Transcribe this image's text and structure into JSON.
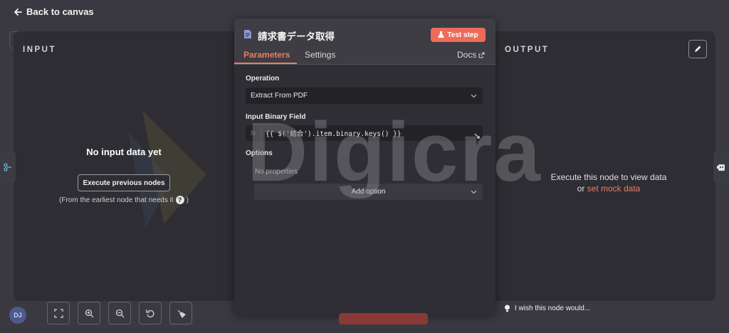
{
  "nav": {
    "back_label": "Back to canvas"
  },
  "input_panel": {
    "label": "INPUT",
    "empty_title": "No input data yet",
    "execute_button": "Execute previous nodes",
    "note": "(From the earliest node that needs it",
    "note_end": ")"
  },
  "output_panel": {
    "label": "OUTPUT",
    "message": "Execute this node to view data",
    "or_text": "or",
    "mock_link": "set mock data"
  },
  "node": {
    "title": "請求書データ取得",
    "test_button": "Test step",
    "tabs": {
      "parameters": "Parameters",
      "settings": "Settings",
      "docs": "Docs"
    },
    "operation_label": "Operation",
    "operation_value": "Extract From PDF",
    "binary_field_label": "Input Binary Field",
    "binary_field_value": "{{ $('結合').item.binary.keys() }}",
    "options_label": "Options",
    "no_properties": "No properties",
    "add_option": "Add option"
  },
  "watermark": "Digicra",
  "footer": {
    "avatar_initials": "DJ",
    "wish": "I wish this node would..."
  },
  "colors": {
    "accent": "#f07b65",
    "test_button": "#ee6b5a"
  }
}
